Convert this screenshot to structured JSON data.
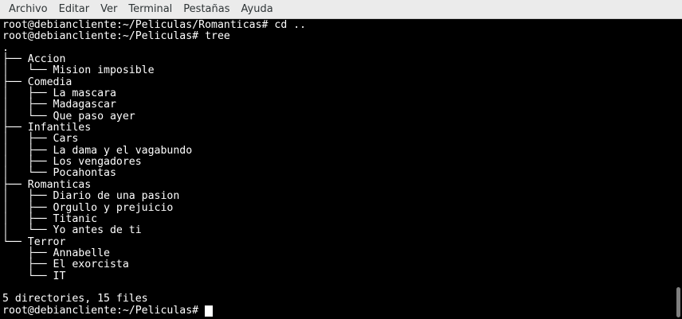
{
  "menu": {
    "items": [
      "Archivo",
      "Editar",
      "Ver",
      "Terminal",
      "Pestañas",
      "Ayuda"
    ]
  },
  "terminal": {
    "lines": [
      "root@debiancliente:~/Peliculas/Romanticas# cd ..",
      "root@debiancliente:~/Peliculas# tree",
      ".",
      "├── Accion",
      "│   └── Mision imposible",
      "├── Comedia",
      "│   ├── La mascara",
      "│   ├── Madagascar",
      "│   └── Que paso ayer",
      "├── Infantiles",
      "│   ├── Cars",
      "│   ├── La dama y el vagabundo",
      "│   ├── Los vengadores",
      "│   └── Pocahontas",
      "├── Romanticas",
      "│   ├── Diario de una pasion",
      "│   ├── Orgullo y prejuicio",
      "│   ├── Titanic",
      "│   └── Yo antes de ti",
      "└── Terror",
      "    ├── Annabelle",
      "    ├── El exorcista",
      "    └── IT",
      "",
      "5 directories, 15 files"
    ],
    "prompt": "root@debiancliente:~/Peliculas# "
  },
  "colors": {
    "background": "#000000",
    "foreground": "#ffffff",
    "menubar": "#ebebeb"
  }
}
